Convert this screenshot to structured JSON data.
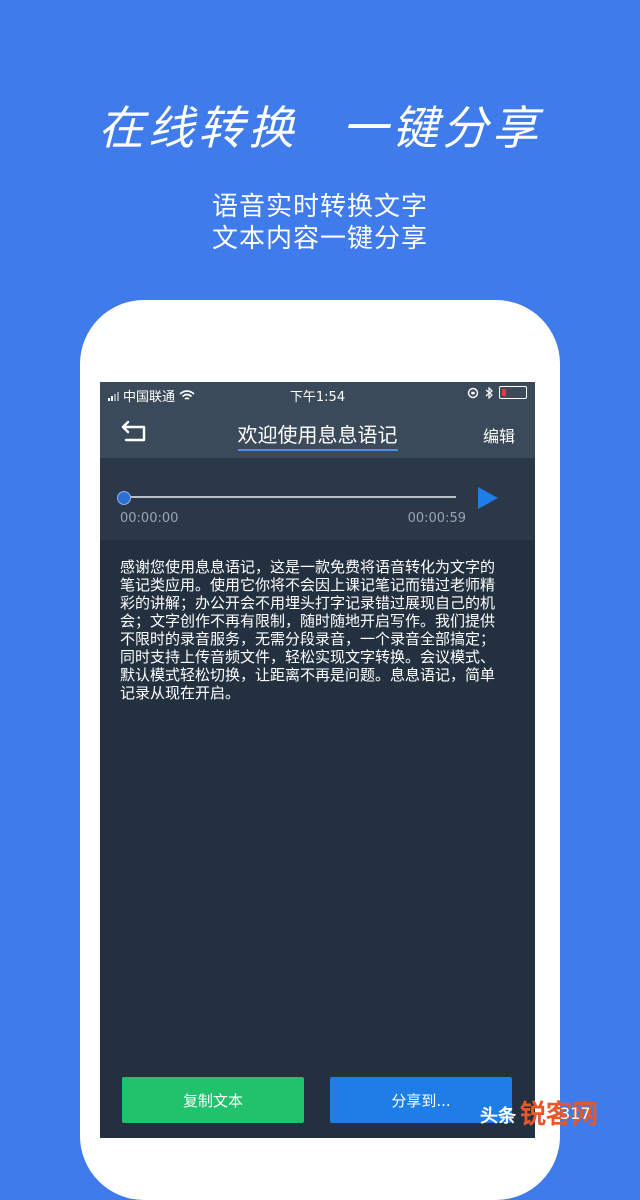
{
  "headline": {
    "part1": "在线转换",
    "part2": "一键分享"
  },
  "subtitle": {
    "line1": "语音实时转换文字",
    "line2": "文本内容一键分享"
  },
  "status_bar": {
    "carrier": "中国联通",
    "time": "下午1:54"
  },
  "nav": {
    "title": "欢迎使用息息语记",
    "edit_label": "编辑"
  },
  "player": {
    "current_time": "00:00:00",
    "total_time": "00:00:59",
    "progress": 0.0
  },
  "body_text": "感谢您使用息息语记，这是一款免费将语音转化为文字的笔记类应用。使用它你将不会因上课记笔记而错过老师精彩的讲解；办公开会不用埋头打字记录错过展现自己的机会；文字创作不再有限制，随时随地开启写作。我们提供不限时的录音服务，无需分段录音，一个录音全部搞定；同时支持上传音频文件，轻松实现文字转换。会议模式、默认模式轻松切换，让距离不再是问题。息息语记，简单记录从现在开启。",
  "buttons": {
    "copy_label": "复制文本",
    "share_label": "分享到..."
  },
  "watermark": {
    "left": "头条",
    "right": "锐客网",
    "sub": "317"
  },
  "colors": {
    "background": "#3f7bea",
    "screen": "#23303f",
    "copy_button": "#20c26b",
    "share_button": "#1f7de8",
    "accent": "#1f7de8"
  }
}
